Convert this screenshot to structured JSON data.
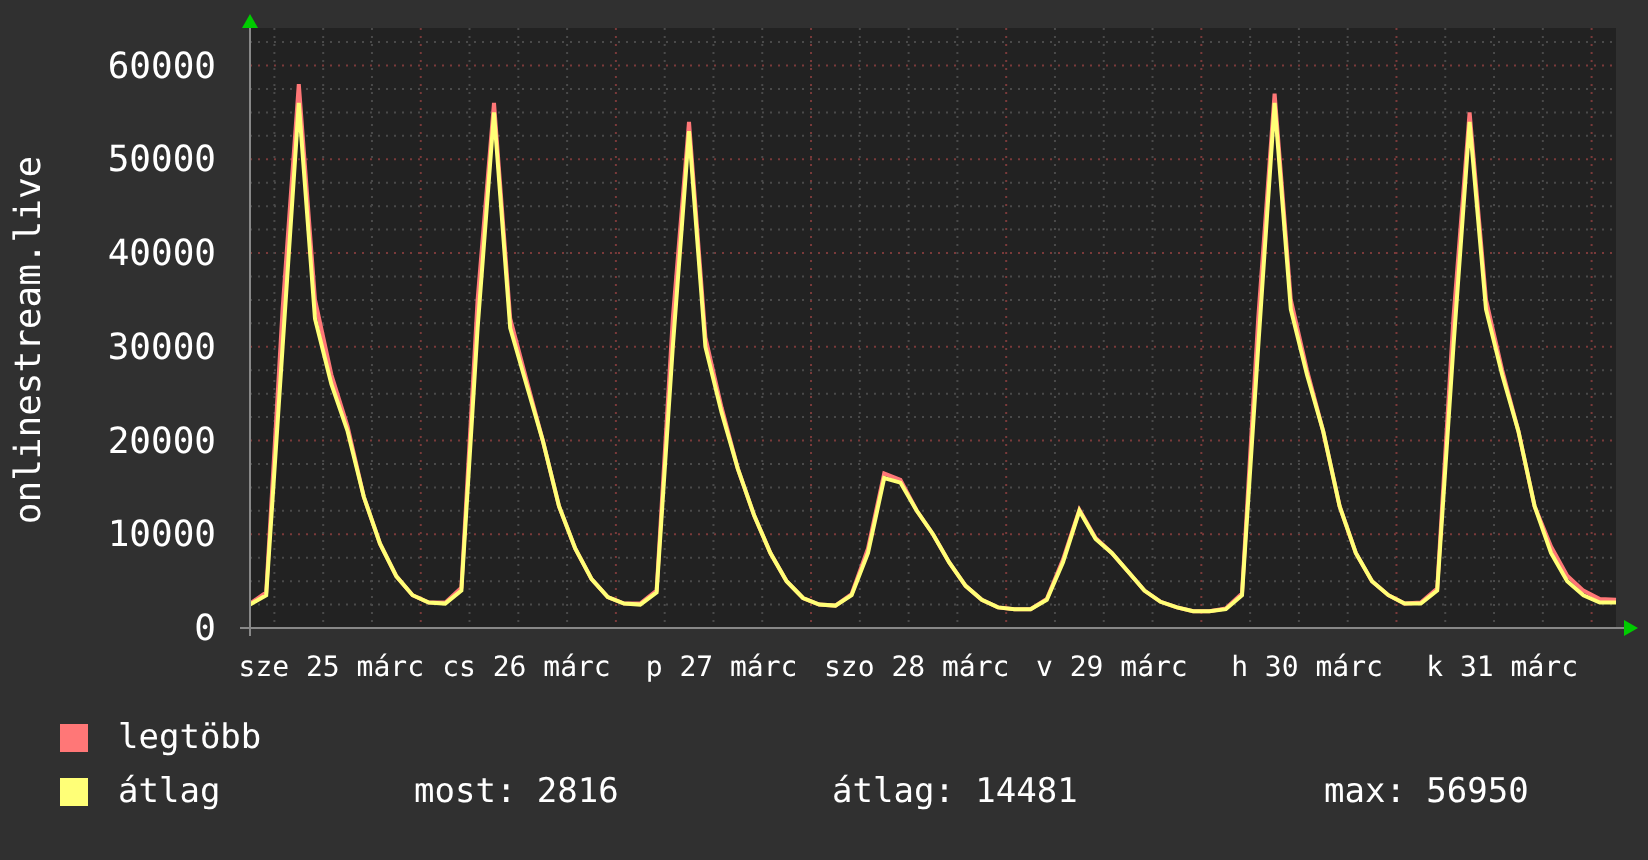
{
  "chart_data": {
    "type": "line",
    "ylabel": "onlinestream.live",
    "grid": true,
    "categories": [
      null,
      null,
      null,
      null,
      null,
      "sze 25 márc",
      null,
      null,
      null,
      null,
      null,
      null,
      null,
      null,
      null,
      null,
      null,
      "cs 26 márc",
      null,
      null,
      null,
      null,
      null,
      null,
      null,
      null,
      null,
      null,
      null,
      "p 27 márc",
      null,
      null,
      null,
      null,
      null,
      null,
      null,
      null,
      null,
      null,
      null,
      "szo 28 márc",
      null,
      null,
      null,
      null,
      null,
      null,
      null,
      null,
      null,
      null,
      null,
      "v 29 márc",
      null,
      null,
      null,
      null,
      null,
      null,
      null,
      null,
      null,
      null,
      null,
      "h 30 márc",
      null,
      null,
      null,
      null,
      null,
      null,
      null,
      null,
      null,
      null,
      null,
      "k 31 márc",
      null,
      null,
      null,
      null,
      null,
      null,
      null
    ],
    "ylim": [
      0,
      64000
    ],
    "yticks": [
      0,
      10000,
      20000,
      30000,
      40000,
      50000,
      60000
    ],
    "series": [
      {
        "name": "legtöbb",
        "color": "#ff7777",
        "values": [
          2600,
          3800,
          34000,
          58000,
          35000,
          27000,
          21500,
          14000,
          9000,
          5500,
          3500,
          2700,
          2700,
          4300,
          35000,
          56000,
          33000,
          26500,
          20000,
          13000,
          8500,
          5200,
          3300,
          2600,
          2600,
          4000,
          33000,
          54000,
          31000,
          23500,
          17000,
          12000,
          8000,
          5000,
          3200,
          2500,
          2400,
          3600,
          8500,
          16500,
          15800,
          12500,
          10000,
          7000,
          4500,
          3000,
          2200,
          2000,
          2000,
          3100,
          7300,
          12600,
          9600,
          8000,
          6000,
          4000,
          2800,
          2200,
          1800,
          1800,
          2100,
          3700,
          33000,
          57000,
          35000,
          27500,
          21000,
          13000,
          8000,
          5000,
          3500,
          2600,
          2700,
          4200,
          33000,
          55000,
          35000,
          27500,
          21000,
          13000,
          8700,
          5600,
          4000,
          3100,
          3000
        ]
      },
      {
        "name": "átlag",
        "color": "#ffff77",
        "values": [
          2500,
          3500,
          30000,
          56000,
          33000,
          26000,
          21000,
          14000,
          9000,
          5500,
          3500,
          2700,
          2600,
          4000,
          32000,
          55000,
          32000,
          26000,
          20000,
          13000,
          8500,
          5200,
          3300,
          2600,
          2500,
          3800,
          30000,
          53000,
          30000,
          23000,
          17000,
          12000,
          8000,
          5000,
          3200,
          2500,
          2400,
          3500,
          8000,
          16000,
          15500,
          12500,
          10000,
          7000,
          4500,
          3000,
          2200,
          2000,
          2000,
          3000,
          7000,
          12500,
          9500,
          8000,
          6000,
          4000,
          2800,
          2200,
          1800,
          1800,
          2000,
          3500,
          30000,
          56000,
          34000,
          27000,
          21000,
          13000,
          8000,
          5000,
          3500,
          2600,
          2600,
          4000,
          30000,
          54000,
          34000,
          27000,
          21000,
          13000,
          8000,
          5000,
          3500,
          2700,
          2700
        ]
      }
    ]
  },
  "stats": [
    {
      "label": "most: 2816"
    },
    {
      "label": "átlag: 14481"
    },
    {
      "label": "max: 56950"
    }
  ]
}
